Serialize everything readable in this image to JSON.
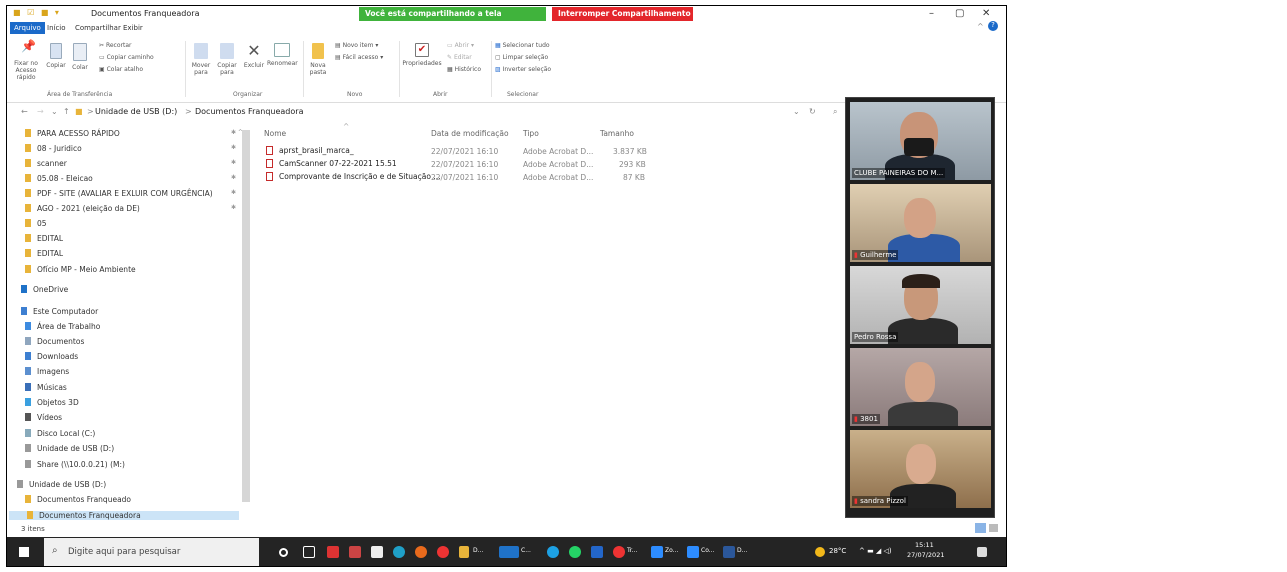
{
  "window": {
    "title": "Documentos Franqueadora",
    "minimize": "–",
    "maximize": "▢",
    "close": "✕",
    "help": "?"
  },
  "screen_share": {
    "status": "Você está compartilhando a tela",
    "stop": "Interromper Compartilhamento"
  },
  "tabs": [
    "Arquivo",
    "Início",
    "Compartilhar",
    "Exibir"
  ],
  "ribbon": {
    "pin": "Fixar no Acesso rápido",
    "copy": "Copiar",
    "paste": "Colar",
    "cut": "Recortar",
    "copy_path": "Copiar caminho",
    "paste_shortcut": "Colar atalho",
    "clipboard_group": "Área de Transferência",
    "move_to": "Mover para",
    "copy_to": "Copiar para",
    "delete": "Excluir",
    "rename": "Renomear",
    "organize_group": "Organizar",
    "new_folder": "Nova pasta",
    "new_item": "Novo item",
    "easy_access": "Fácil acesso",
    "new_group": "Novo",
    "properties": "Propriedades",
    "open": "Abrir",
    "edit": "Editar",
    "history": "Histórico",
    "open_group": "Abrir",
    "select_all": "Selecionar tudo",
    "select_none": "Limpar seleção",
    "invert": "Inverter seleção",
    "select_group": "Selecionar"
  },
  "address": {
    "drive": "Unidade de USB (D:)",
    "folder": "Documentos Franqueadora",
    "sep": ">"
  },
  "nav": [
    {
      "label": "PARA ACESSO RÁPIDO",
      "color": "#e8b43a",
      "pin": "✱ ^"
    },
    {
      "label": "08 - Juridico",
      "color": "#e8b43a",
      "pin": "✱"
    },
    {
      "label": "scanner",
      "color": "#e8b43a",
      "pin": "✱"
    },
    {
      "label": "05.08 - Eleicao",
      "color": "#e8b43a",
      "pin": "✱"
    },
    {
      "label": "PDF - SITE (AVALIAR E EXLUIR COM URGÊNCIA)",
      "color": "#e8b43a",
      "pin": "✱"
    },
    {
      "label": "AGO - 2021 (eleição da DE)",
      "color": "#e8b43a",
      "pin": "✱"
    },
    {
      "label": "05",
      "color": "#e8b43a",
      "pin": ""
    },
    {
      "label": "EDITAL",
      "color": "#e8b43a",
      "pin": ""
    },
    {
      "label": "EDITAL",
      "color": "#e8b43a",
      "pin": ""
    },
    {
      "label": "Ofício MP - Meio Ambiente",
      "color": "#e8b43a",
      "pin": ""
    },
    {
      "label": "OneDrive",
      "color": "#1f72c8",
      "pin": ""
    },
    {
      "label": "Este Computador",
      "color": "#3d7fd1",
      "pin": ""
    },
    {
      "label": "Área de Trabalho",
      "color": "#3d8be0",
      "pin": ""
    },
    {
      "label": "Documentos",
      "color": "#8fa6be",
      "pin": ""
    },
    {
      "label": "Downloads",
      "color": "#3d7fd1",
      "pin": ""
    },
    {
      "label": "Imagens",
      "color": "#5c8fcf",
      "pin": ""
    },
    {
      "label": "Músicas",
      "color": "#3a6fb8",
      "pin": ""
    },
    {
      "label": "Objetos 3D",
      "color": "#3aa0e0",
      "pin": ""
    },
    {
      "label": "Vídeos",
      "color": "#555",
      "pin": ""
    },
    {
      "label": "Disco Local (C:)",
      "color": "#8ab",
      "pin": ""
    },
    {
      "label": "Unidade de USB (D:)",
      "color": "#999",
      "pin": ""
    },
    {
      "label": "Share (\\\\10.0.0.21) (M:)",
      "color": "#999",
      "pin": ""
    },
    {
      "label": "Unidade de USB (D:)",
      "color": "#999",
      "pin": ""
    },
    {
      "label": "Documentos Franqueado",
      "color": "#e8b43a",
      "pin": ""
    },
    {
      "label": "Documentos Franqueadora",
      "color": "#e8b43a",
      "pin": ""
    }
  ],
  "columns": {
    "name": "Nome",
    "date": "Data de modificação",
    "type": "Tipo",
    "size": "Tamanho"
  },
  "files": [
    {
      "name": "aprst_brasil_marca_",
      "date": "22/07/2021 16:10",
      "type": "Adobe Acrobat D...",
      "size": "3.837 KB"
    },
    {
      "name": "CamScanner 07-22-2021 15.51",
      "date": "22/07/2021 16:10",
      "type": "Adobe Acrobat D...",
      "size": "293 KB"
    },
    {
      "name": "Comprovante de Inscrição e de Situação ...",
      "date": "22/07/2021 16:10",
      "type": "Adobe Acrobat D...",
      "size": "87 KB"
    }
  ],
  "status": "3 itens",
  "taskbar": {
    "search": "Digite aqui para pesquisar",
    "apps": [
      "D...",
      "C...",
      "Tr...",
      "Zo...",
      "Co...",
      "D..."
    ],
    "weather": "28°C",
    "time": "15:11",
    "date": "27/07/2021"
  },
  "participants": [
    "CLUBE PAINEIRAS DO M...",
    "Guilherme",
    "Pedro Rossa",
    "3801",
    "sandra Pizzol"
  ]
}
